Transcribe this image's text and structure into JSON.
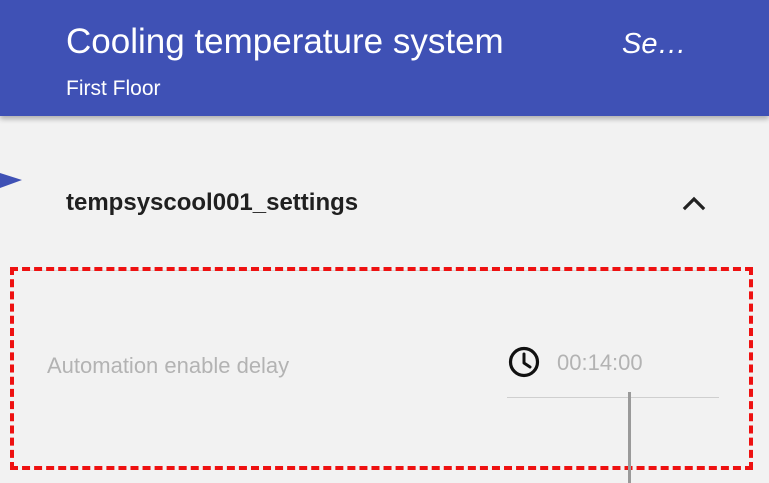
{
  "header": {
    "title": "Cooling temperature system",
    "side_label": "Se…",
    "subtitle": "First Floor",
    "background_color": "#3f51b5"
  },
  "section": {
    "title": "tempsyscool001_settings",
    "toggle_icon": "chevron-up-icon"
  },
  "setting": {
    "label": "Automation enable delay",
    "icon": "clock-icon",
    "value": "00:14:00"
  },
  "annotations": {
    "highlight_color": "#ee1111",
    "pointer_icon": "arrow-right-icon"
  }
}
